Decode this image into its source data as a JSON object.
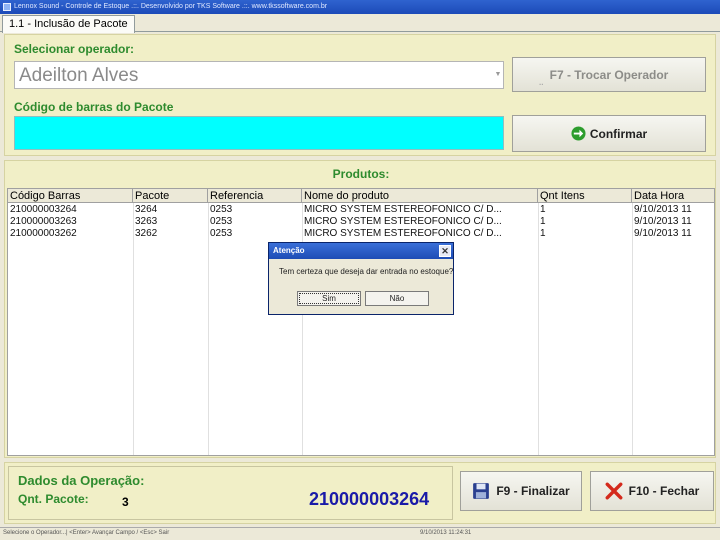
{
  "window": {
    "title": "Lennox Sound - Controle de Estoque .::. Desenvolvido por TKS Software .::. www.tkssoftware.com.br"
  },
  "tab": {
    "label": "1.1 - Inclusão de Pacote"
  },
  "operator": {
    "label": "Selecionar operador:",
    "value": "Adeilton Alves",
    "change_button": "F7 - Trocar Operador"
  },
  "barcode": {
    "label": "Código de barras do Pacote",
    "value": "",
    "confirm_button": "Confirmar"
  },
  "products": {
    "title": "Produtos:",
    "columns": [
      "Código Barras",
      "Pacote",
      "Referencia",
      "Nome do produto",
      "Qnt Itens",
      "Data Hora"
    ],
    "rows": [
      [
        "210000003264",
        "3264",
        "0253",
        "MICRO SYSTEM ESTEREOFONICO C/ D...",
        "1",
        "9/10/2013 11"
      ],
      [
        "210000003263",
        "3263",
        "0253",
        "MICRO SYSTEM ESTEREOFONICO C/ D...",
        "1",
        "9/10/2013 11"
      ],
      [
        "210000003262",
        "3262",
        "0253",
        "MICRO SYSTEM ESTEREOFONICO C/ D...",
        "1",
        "9/10/2013 11"
      ]
    ]
  },
  "dialog": {
    "title": "Atenção",
    "message": "Tem certeza que deseja dar entrada no estoque?",
    "yes_button": "Sim",
    "no_button": "Não"
  },
  "operation": {
    "title": "Dados da Operação:",
    "qnt_label": "Qnt. Pacote:",
    "qnt_value": "3",
    "last_code": "210000003264",
    "finalize_button": "F9 - Finalizar",
    "close_button": "F10 - Fechar"
  },
  "status": {
    "left": "Selecione o Operador...| <Enter> Avançar Campo / <Esc> Sair",
    "right": "9/10/2013 11:24:31"
  },
  "colors": {
    "panel_bg": "#f1efc7",
    "label_green": "#2e8b2e",
    "barcode_bg": "#00ffff",
    "code_blue": "#1a1aa8"
  }
}
